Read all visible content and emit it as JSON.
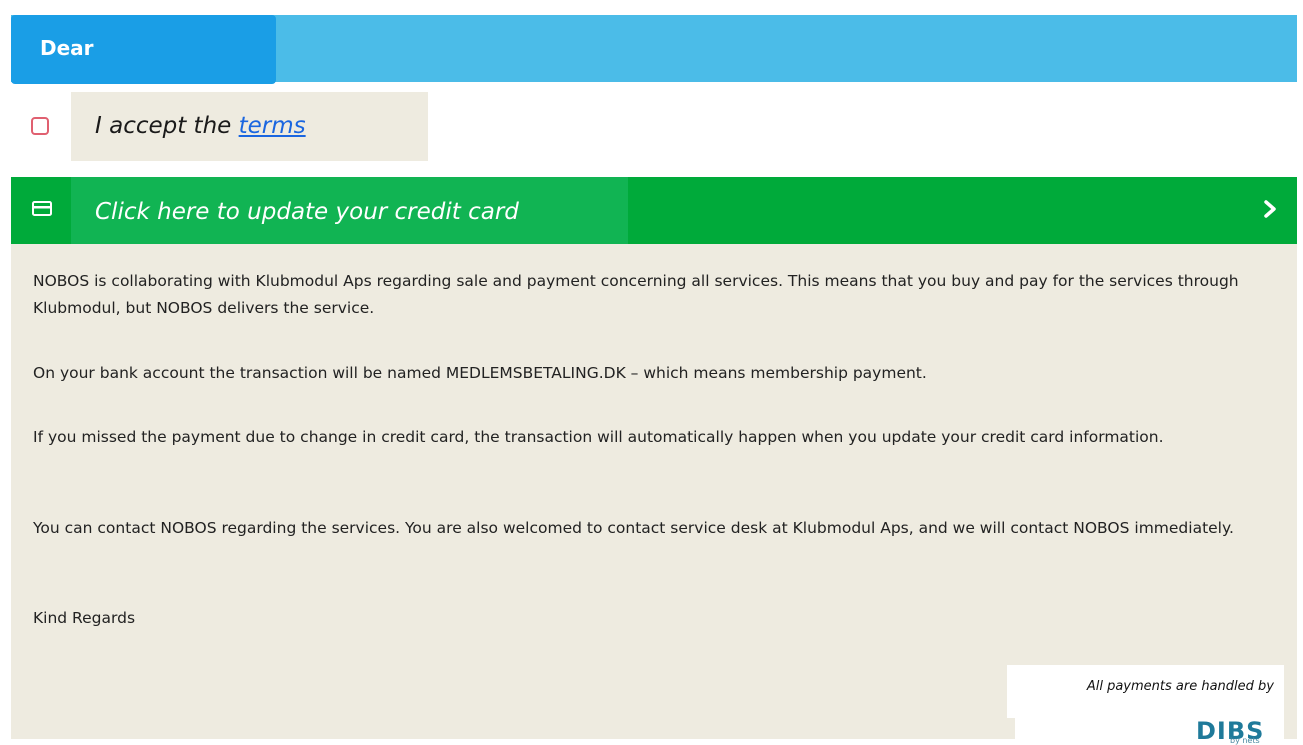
{
  "header": {
    "title": "Dear"
  },
  "terms": {
    "prefix": "I accept the ",
    "link_label": "terms"
  },
  "card_banner": {
    "label": "Click here to update your credit card"
  },
  "info": {
    "paragraphs": [
      "NOBOS is collaborating with Klubmodul Aps regarding sale and payment concerning all services. This means that you buy and pay for the services through Klubmodul, but NOBOS delivers the service.",
      "On your bank account the transaction will be named MEDLEMSBETALING.DK – which means membership payment.",
      "If you missed the payment due to change in credit card, the transaction will automatically happen when you update your credit card information.",
      "You can contact NOBOS regarding the services. You are also welcomed to contact service desk at Klubmodul Aps, and we will contact NOBOS immediately.",
      "Kind Regards"
    ]
  },
  "payment": {
    "handled_by": "All payments are handled by",
    "logo_text": "DIBS",
    "logo_sub": "by nets"
  },
  "colors": {
    "header_band": "#4bbce8",
    "header_tab": "#1a9ee6",
    "banner_green": "#00aa3a",
    "banner_tab_green": "#11b453",
    "panel_beige": "#eeebe0",
    "link_blue": "#1a66e0",
    "checkbox_border": "#e06070"
  },
  "icons": {
    "card": "credit-card-icon",
    "chevron": "chevron-right-icon",
    "checkbox": "checkbox-icon"
  }
}
